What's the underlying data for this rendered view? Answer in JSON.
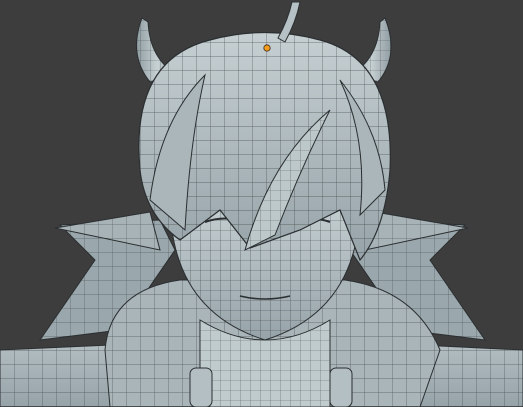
{
  "viewport": {
    "background": "#3d3d3d",
    "mesh_fill": "#b7c3c7",
    "mesh_shade": "#8e9ba0",
    "wire_color": "#2b2f31",
    "origin_color": "#f39a1f"
  },
  "scene": {
    "object": "character-head-mesh",
    "parts": [
      "horns",
      "hair",
      "ahoge",
      "face",
      "ears",
      "collar",
      "shoulders"
    ]
  }
}
